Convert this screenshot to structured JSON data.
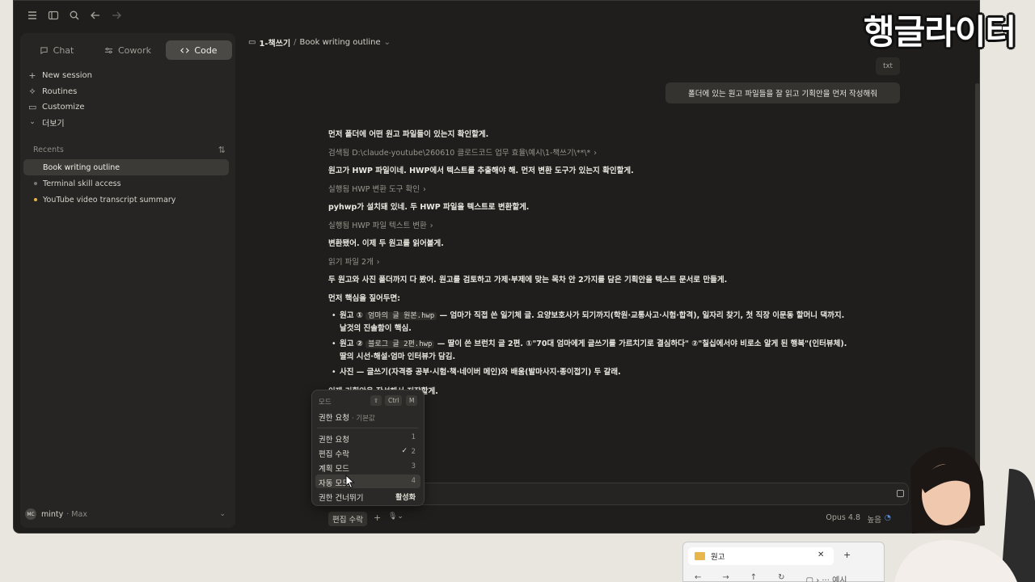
{
  "sidebar": {
    "modes": [
      {
        "label": "Chat",
        "icon": "chat-bubble-icon",
        "active": false
      },
      {
        "label": "Cowork",
        "icon": "sliders-icon",
        "active": false
      },
      {
        "label": "Code",
        "icon": "code-brackets-icon",
        "active": true
      }
    ],
    "nav": [
      {
        "label": "New session",
        "icon": "plus-icon"
      },
      {
        "label": "Routines",
        "icon": "routine-icon"
      },
      {
        "label": "Customize",
        "icon": "briefcase-icon"
      },
      {
        "label": "더보기",
        "icon": "chevron-down-icon"
      }
    ],
    "recents_label": "Recents",
    "recents": [
      {
        "label": "Book writing outline",
        "active": true,
        "dot": ""
      },
      {
        "label": "Terminal skill access",
        "active": false,
        "dot": "#7a7772"
      },
      {
        "label": "YouTube video transcript summary",
        "active": false,
        "dot": "#e8b63e"
      }
    ],
    "user": {
      "initials": "MC",
      "name": "minty",
      "plan": "· Max"
    }
  },
  "header": {
    "project": "1-책쓰기",
    "separator": "/",
    "session": "Book writing outline"
  },
  "conversation": {
    "attachment": "txt",
    "user_message": "폴더에 있는 원고 파일들을 잘 읽고 기획안을 먼저 작성해줘",
    "lines": [
      {
        "kind": "text",
        "text": "먼저 폴더에 어떤 원고 파일들이 있는지 확인할게."
      },
      {
        "kind": "tool",
        "text": "검색됨 D:\\claude-youtube\\260610 클로드코드 업무 효율\\예시\\1-책쓰기\\**\\*",
        "chev": "›"
      },
      {
        "kind": "text",
        "text": "원고가 HWP 파일이네. HWP에서 텍스트를 추출해야 해. 먼저 변환 도구가 있는지 확인할게."
      },
      {
        "kind": "tool",
        "text": "실행됨 HWP 변환 도구 확인",
        "chev": "›"
      },
      {
        "kind": "text",
        "text": "pyhwp가 설치돼 있네. 두 HWP 파일을 텍스트로 변환할게."
      },
      {
        "kind": "tool",
        "text": "실행됨 HWP 파일 텍스트 변환",
        "chev": "›"
      },
      {
        "kind": "text",
        "text": "변환됐어. 이제 두 원고를 읽어볼게."
      },
      {
        "kind": "tool",
        "text": "읽기 파일 2개",
        "chev": "›"
      },
      {
        "kind": "text",
        "text": "두 원고와 사진 폴더까지 다 봤어. 원고를 검토하고 가제·부제에 맞는 목차 안 2가지를 담은 기획안을 텍스트 문서로 만들게."
      },
      {
        "kind": "text",
        "text": "먼저 핵심을 짚어두면:"
      }
    ],
    "bullets": [
      {
        "pre": "원고 ① ",
        "code": "엄마의 글 원본.hwp",
        "post": " — 엄마가 직접 쓴 일기체 글. 요양보호사가 되기까지(학원·교통사고·시험·합격), 일자리 찾기, 첫 직장 이문동 할머니 댁까지.",
        "cont": "날것의 진솔함이 핵심."
      },
      {
        "pre": "원고 ② ",
        "code": "블로그 글 2편.hwp",
        "post": " — 딸이 쓴 브런치 글 2편. ①\"70대 엄마에게 글쓰기를 가르치기로 결심하다\" ②\"칠십에서야 비로소 알게 된 행복\"(인터뷰체).",
        "cont": "딸의 시선·해설·엄마 인터뷰가 담김."
      },
      {
        "pre": "사진 — 글쓰기(자격증 공부·시험·책·네이버 메인)와 배움(발마사지·종이접기) 두 갈래.",
        "code": "",
        "post": "",
        "cont": ""
      }
    ],
    "trailing": "이제 기획안을 작성해서 저장할게."
  },
  "mode_menu": {
    "header": "모드",
    "shortcut": [
      "⇧",
      "Ctrl",
      "M"
    ],
    "current": "권한 요청",
    "current_suffix": "· 기본값",
    "items": [
      {
        "label": "권한 요청",
        "num": "1",
        "checked": false,
        "highlighted": false
      },
      {
        "label": "편집 수락",
        "num": "2",
        "checked": true,
        "highlighted": false
      },
      {
        "label": "계획 모드",
        "num": "3",
        "checked": false,
        "highlighted": false
      },
      {
        "label": "자동 모드",
        "num": "4",
        "checked": false,
        "highlighted": true
      }
    ],
    "skip": {
      "label": "권한 건너뛰기",
      "value": "활성화"
    }
  },
  "composer": {
    "permission_mode": "편집 수락",
    "model": "Opus 4.8",
    "effort": "높음"
  },
  "explorer": {
    "tab_title": "원고",
    "address_partial": "예시"
  },
  "branding": {
    "text": "행글라이터"
  },
  "colors": {
    "app_bg": "#1f1e1c",
    "sidebar_bg": "#262523",
    "active_tab": "#4b4945",
    "accent_dot": "#e8b63e"
  }
}
